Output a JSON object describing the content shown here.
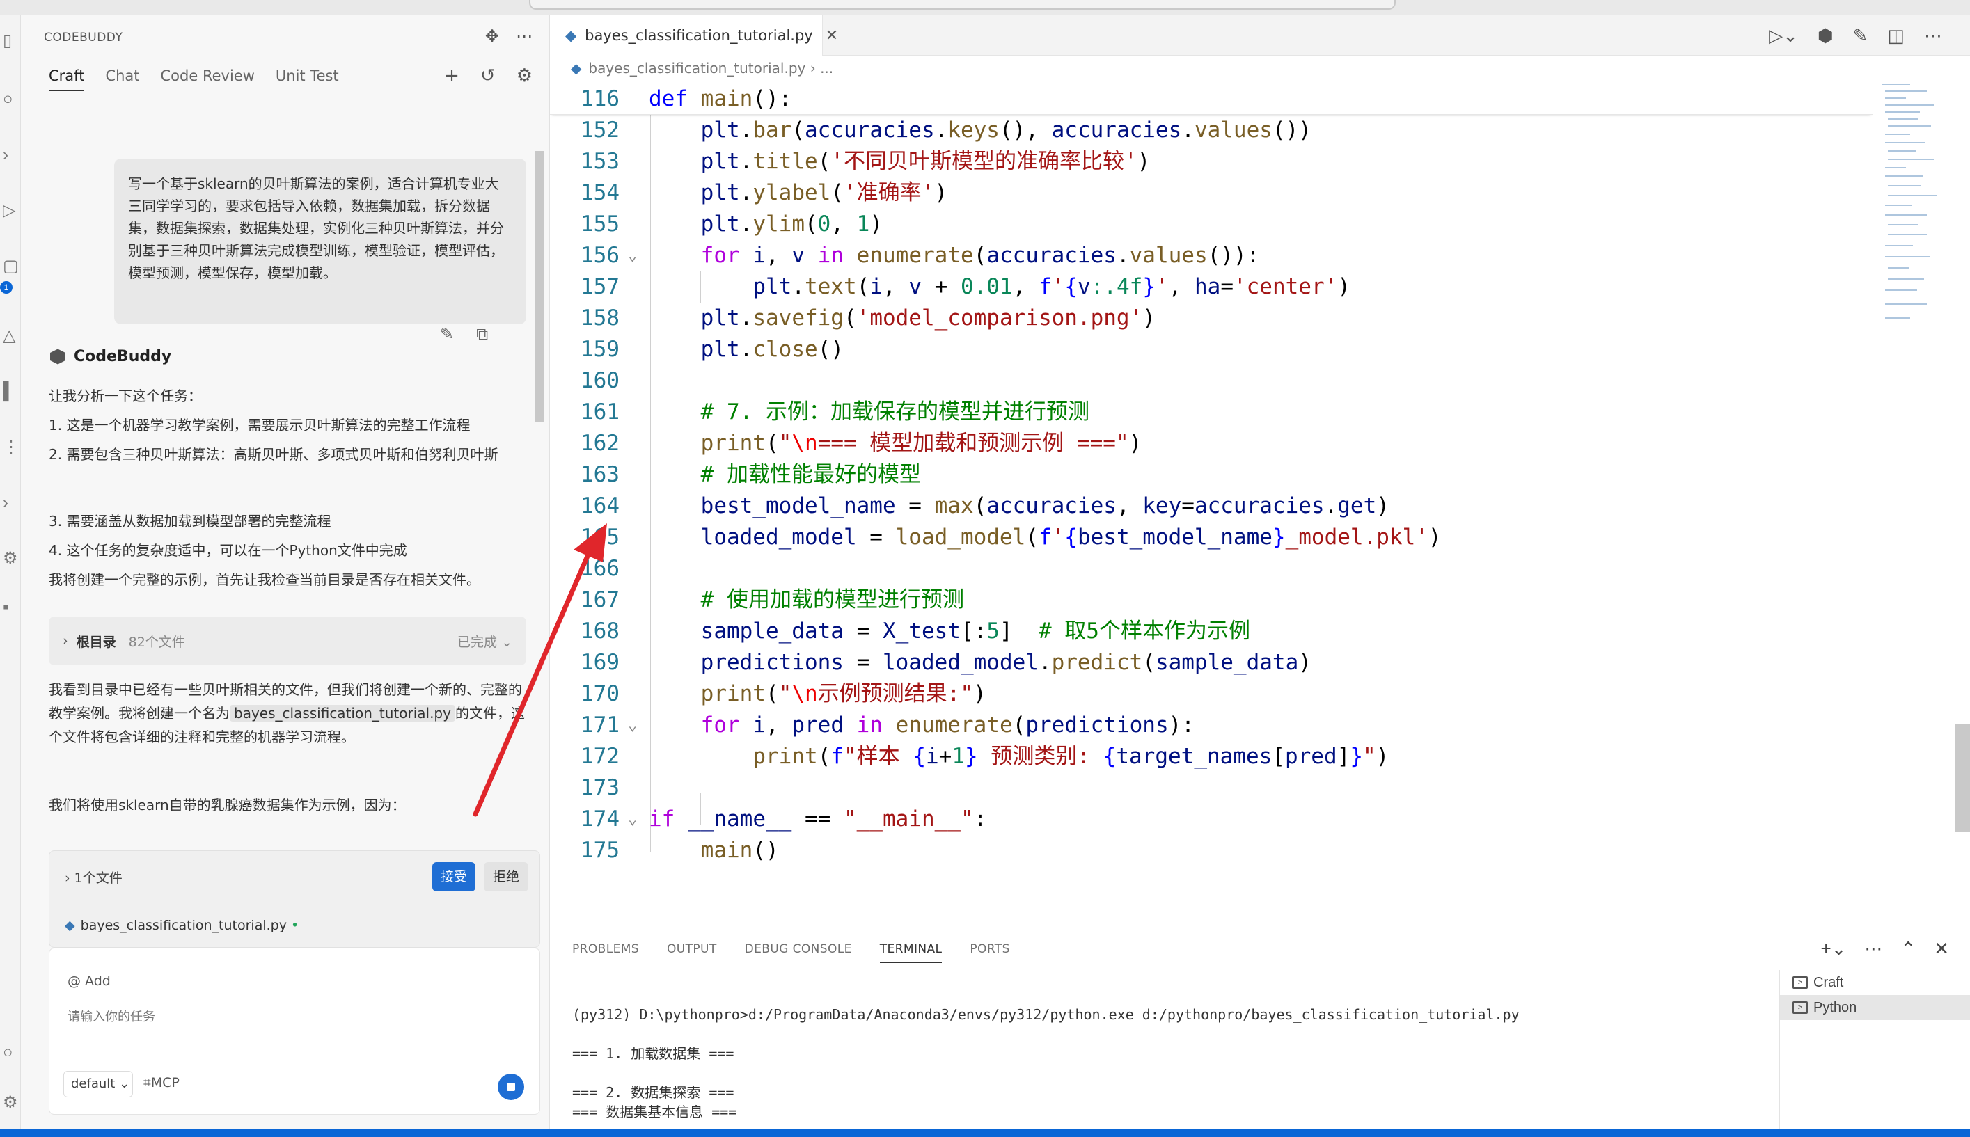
{
  "sidebar": {
    "title": "CODEBUDDY",
    "tabs": [
      "Craft",
      "Chat",
      "Code Review",
      "Unit Test"
    ],
    "badge_count": "1"
  },
  "chat": {
    "user_message": "写一个基于sklearn的贝叶斯算法的案例，适合计算机专业大三同学学习的，要求包括导入依赖，数据集加载，拆分数据集，数据集探索，数据集处理，实例化三种贝叶斯算法，并分别基于三种贝叶斯算法完成模型训练，模型验证，模型评估，模型预测，模型保存，模型加载。",
    "bot_name": "CodeBuddy",
    "analysis_intro": "让我分析一下这个任务：",
    "analysis_points": [
      "1. 这是一个机器学习教学案例，需要展示贝叶斯算法的完整工作流程",
      "2. 需要包含三种贝叶斯算法：高斯贝叶斯、多项式贝叶斯和伯努利贝叶斯",
      "3. 需要涵盖从数据加载到模型部署的完整流程",
      "4. 这个任务的复杂度适中，可以在一个Python文件中完成"
    ],
    "plan_text": "我将创建一个完整的示例，首先让我检查当前目录是否存在相关文件。",
    "folder_box": {
      "name": "根目录",
      "count": "82个文件",
      "status": "已完成"
    },
    "followup_before": "我看到目录中已经有一些贝叶斯相关的文件，但我们将创建一个新的、完整的教学案例。我将创建一个名为",
    "followup_filename": "bayes_classification_tutorial.py",
    "followup_after": "的文件，这个文件将包含详细的注释和完整的机器学习流程。",
    "dataset_text": "我们将使用sklearn自带的乳腺癌数据集作为示例，因为：",
    "file_changes": {
      "count_label": "1个文件",
      "accept": "接受",
      "reject": "拒绝",
      "filename": "bayes_classification_tutorial.py"
    },
    "input": {
      "add_label": "@ Add",
      "placeholder": "请输入你的任务",
      "mode": "default",
      "mcp": "MCP"
    }
  },
  "editor": {
    "tab_name": "bayes_classification_tutorial.py",
    "breadcrumb": "bayes_classification_tutorial.py",
    "breadcrumb_more": "...",
    "line_numbers": [
      "116",
      "152",
      "153",
      "154",
      "155",
      "156",
      "157",
      "158",
      "159",
      "160",
      "161",
      "162",
      "163",
      "164",
      "165",
      "166",
      "167",
      "168",
      "169",
      "170",
      "171",
      "172",
      "173",
      "174",
      "175"
    ]
  },
  "terminal": {
    "tabs": [
      "PROBLEMS",
      "OUTPUT",
      "DEBUG CONSOLE",
      "TERMINAL",
      "PORTS"
    ],
    "active_tab": "TERMINAL",
    "output_lines": [
      "(py312) D:\\pythonpro>d:/ProgramData/Anaconda3/envs/py312/python.exe d:/pythonpro/bayes_classification_tutorial.py",
      "",
      "=== 1. 加载数据集 ===",
      "",
      "=== 2. 数据集探索 ===",
      "=== 数据集基本信息 ==="
    ],
    "shells": [
      "Craft",
      "Python"
    ]
  },
  "colors": {
    "accent": "#1f6ed4",
    "annotation_arrow": "#e0262b",
    "statusbar": "#0a66d6"
  }
}
